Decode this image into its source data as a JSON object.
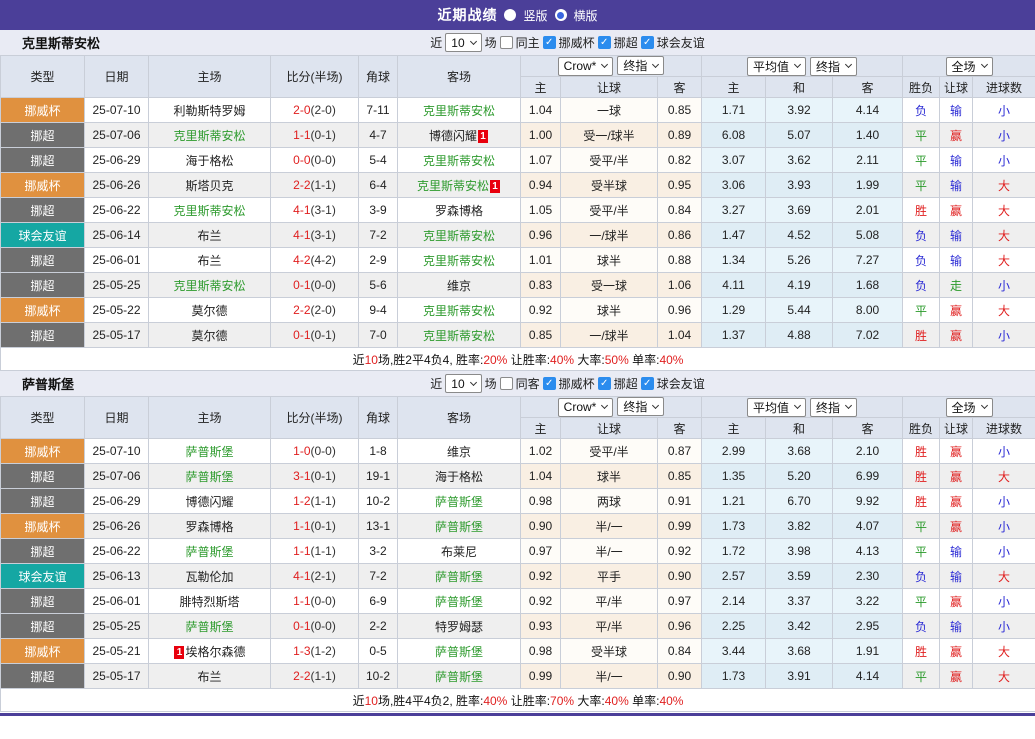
{
  "title_bar": {
    "title": "近期战绩",
    "radios": [
      {
        "label": "竖版",
        "selected": false
      },
      {
        "label": "横版",
        "selected": true
      }
    ]
  },
  "colors": {
    "accent_purple": "#4B3F99",
    "cup_orange": "#E0913F",
    "league_gray": "#6F6F6F",
    "friendly_teal": "#15A7A3",
    "focus_team_green": "#2E9B2E",
    "result_red": "#E01F1F",
    "result_green": "#2A9A2A",
    "result_blue": "#2B2BD5",
    "red_card": "#E8000D"
  },
  "filters": {
    "prefix": "近",
    "count": "10",
    "suffix": "场",
    "leagues": [
      "挪威杯",
      "挪超",
      "球会友谊"
    ]
  },
  "table_columns": {
    "left": [
      "类型",
      "日期",
      "主场",
      "比分(半场)",
      "角球",
      "客场"
    ],
    "sub": [
      "主",
      "让球",
      "客",
      "主",
      "和",
      "客",
      "胜负",
      "让球",
      "进球数"
    ]
  },
  "dropdowns": {
    "bookmaker": "Crow*",
    "final1": "终指",
    "average": "平均值",
    "final2": "终指",
    "scope": "全场"
  },
  "type_class_map": {
    "挪威杯": "t-cup",
    "挪超": "t-lge",
    "球会友谊": "t-fri"
  },
  "result_colors": {
    "胜": "red",
    "平": "green",
    "负": "blue",
    "赢": "red",
    "走": "green",
    "输": "blue",
    "大": "red",
    "小": "blue"
  },
  "sections": [
    {
      "team": "克里斯蒂安松",
      "same_option": "同主",
      "rows": [
        {
          "type": "挪威杯",
          "date": "25-07-10",
          "home": "利勒斯特罗姆",
          "home_focus": false,
          "home_red": "",
          "score": "2-0",
          "half": "(2-0)",
          "corner": "7-11",
          "away": "克里斯蒂安松",
          "away_focus": true,
          "away_red": "",
          "ah": [
            "1.04",
            "一球",
            "0.85"
          ],
          "eu": [
            "1.71",
            "3.92",
            "4.14"
          ],
          "res": [
            "负",
            "输",
            "小"
          ]
        },
        {
          "type": "挪超",
          "date": "25-07-06",
          "home": "克里斯蒂安松",
          "home_focus": true,
          "home_red": "",
          "score": "1-1",
          "half": "(0-1)",
          "corner": "4-7",
          "away": "博德闪耀",
          "away_focus": false,
          "away_red": "after",
          "ah": [
            "1.00",
            "受一/球半",
            "0.89"
          ],
          "eu": [
            "6.08",
            "5.07",
            "1.40"
          ],
          "res": [
            "平",
            "赢",
            "小"
          ]
        },
        {
          "type": "挪超",
          "date": "25-06-29",
          "home": "海于格松",
          "home_focus": false,
          "home_red": "",
          "score": "0-0",
          "half": "(0-0)",
          "corner": "5-4",
          "away": "克里斯蒂安松",
          "away_focus": true,
          "away_red": "",
          "ah": [
            "1.07",
            "受平/半",
            "0.82"
          ],
          "eu": [
            "3.07",
            "3.62",
            "2.11"
          ],
          "res": [
            "平",
            "输",
            "小"
          ]
        },
        {
          "type": "挪威杯",
          "date": "25-06-26",
          "home": "斯塔贝克",
          "home_focus": false,
          "home_red": "",
          "score": "2-2",
          "half": "(1-1)",
          "corner": "6-4",
          "away": "克里斯蒂安松",
          "away_focus": true,
          "away_red": "after",
          "ah": [
            "0.94",
            "受半球",
            "0.95"
          ],
          "eu": [
            "3.06",
            "3.93",
            "1.99"
          ],
          "res": [
            "平",
            "输",
            "大"
          ]
        },
        {
          "type": "挪超",
          "date": "25-06-22",
          "home": "克里斯蒂安松",
          "home_focus": true,
          "home_red": "",
          "score": "4-1",
          "half": "(3-1)",
          "corner": "3-9",
          "away": "罗森博格",
          "away_focus": false,
          "away_red": "",
          "ah": [
            "1.05",
            "受平/半",
            "0.84"
          ],
          "eu": [
            "3.27",
            "3.69",
            "2.01"
          ],
          "res": [
            "胜",
            "赢",
            "大"
          ]
        },
        {
          "type": "球会友谊",
          "date": "25-06-14",
          "home": "布兰",
          "home_focus": false,
          "home_red": "",
          "score": "4-1",
          "half": "(3-1)",
          "corner": "7-2",
          "away": "克里斯蒂安松",
          "away_focus": true,
          "away_red": "",
          "ah": [
            "0.96",
            "一/球半",
            "0.86"
          ],
          "eu": [
            "1.47",
            "4.52",
            "5.08"
          ],
          "res": [
            "负",
            "输",
            "大"
          ]
        },
        {
          "type": "挪超",
          "date": "25-06-01",
          "home": "布兰",
          "home_focus": false,
          "home_red": "",
          "score": "4-2",
          "half": "(4-2)",
          "corner": "2-9",
          "away": "克里斯蒂安松",
          "away_focus": true,
          "away_red": "",
          "ah": [
            "1.01",
            "球半",
            "0.88"
          ],
          "eu": [
            "1.34",
            "5.26",
            "7.27"
          ],
          "res": [
            "负",
            "输",
            "大"
          ]
        },
        {
          "type": "挪超",
          "date": "25-05-25",
          "home": "克里斯蒂安松",
          "home_focus": true,
          "home_red": "",
          "score": "0-1",
          "half": "(0-0)",
          "corner": "5-6",
          "away": "维京",
          "away_focus": false,
          "away_red": "",
          "ah": [
            "0.83",
            "受一球",
            "1.06"
          ],
          "eu": [
            "4.11",
            "4.19",
            "1.68"
          ],
          "res": [
            "负",
            "走",
            "小"
          ]
        },
        {
          "type": "挪威杯",
          "date": "25-05-22",
          "home": "莫尔德",
          "home_focus": false,
          "home_red": "",
          "score": "2-2",
          "half": "(2-0)",
          "corner": "9-4",
          "away": "克里斯蒂安松",
          "away_focus": true,
          "away_red": "",
          "ah": [
            "0.92",
            "球半",
            "0.96"
          ],
          "eu": [
            "1.29",
            "5.44",
            "8.00"
          ],
          "res": [
            "平",
            "赢",
            "大"
          ]
        },
        {
          "type": "挪超",
          "date": "25-05-17",
          "home": "莫尔德",
          "home_focus": false,
          "home_red": "",
          "score": "0-1",
          "half": "(0-1)",
          "corner": "7-0",
          "away": "克里斯蒂安松",
          "away_focus": true,
          "away_red": "",
          "ah": [
            "0.85",
            "一/球半",
            "1.04"
          ],
          "eu": [
            "1.37",
            "4.88",
            "7.02"
          ],
          "res": [
            "胜",
            "赢",
            "小"
          ]
        }
      ],
      "summary": [
        {
          "t": "近",
          "c": "k"
        },
        {
          "t": "10",
          "c": "r"
        },
        {
          "t": "场,胜2平4负4, 胜率:",
          "c": "k"
        },
        {
          "t": "20%",
          "c": "r"
        },
        {
          "t": " 让胜率:",
          "c": "k"
        },
        {
          "t": "40%",
          "c": "r"
        },
        {
          "t": " 大率:",
          "c": "k"
        },
        {
          "t": "50%",
          "c": "r"
        },
        {
          "t": " 单率:",
          "c": "k"
        },
        {
          "t": "40%",
          "c": "r"
        }
      ]
    },
    {
      "team": "萨普斯堡",
      "same_option": "同客",
      "rows": [
        {
          "type": "挪威杯",
          "date": "25-07-10",
          "home": "萨普斯堡",
          "home_focus": true,
          "home_red": "",
          "score": "1-0",
          "half": "(0-0)",
          "corner": "1-8",
          "away": "维京",
          "away_focus": false,
          "away_red": "",
          "ah": [
            "1.02",
            "受平/半",
            "0.87"
          ],
          "eu": [
            "2.99",
            "3.68",
            "2.10"
          ],
          "res": [
            "胜",
            "赢",
            "小"
          ]
        },
        {
          "type": "挪超",
          "date": "25-07-06",
          "home": "萨普斯堡",
          "home_focus": true,
          "home_red": "",
          "score": "3-1",
          "half": "(0-1)",
          "corner": "19-1",
          "away": "海于格松",
          "away_focus": false,
          "away_red": "",
          "ah": [
            "1.04",
            "球半",
            "0.85"
          ],
          "eu": [
            "1.35",
            "5.20",
            "6.99"
          ],
          "res": [
            "胜",
            "赢",
            "大"
          ]
        },
        {
          "type": "挪超",
          "date": "25-06-29",
          "home": "博德闪耀",
          "home_focus": false,
          "home_red": "",
          "score": "1-2",
          "half": "(1-1)",
          "corner": "10-2",
          "away": "萨普斯堡",
          "away_focus": true,
          "away_red": "",
          "ah": [
            "0.98",
            "两球",
            "0.91"
          ],
          "eu": [
            "1.21",
            "6.70",
            "9.92"
          ],
          "res": [
            "胜",
            "赢",
            "小"
          ]
        },
        {
          "type": "挪威杯",
          "date": "25-06-26",
          "home": "罗森博格",
          "home_focus": false,
          "home_red": "",
          "score": "1-1",
          "half": "(0-1)",
          "corner": "13-1",
          "away": "萨普斯堡",
          "away_focus": true,
          "away_red": "",
          "ah": [
            "0.90",
            "半/一",
            "0.99"
          ],
          "eu": [
            "1.73",
            "3.82",
            "4.07"
          ],
          "res": [
            "平",
            "赢",
            "小"
          ]
        },
        {
          "type": "挪超",
          "date": "25-06-22",
          "home": "萨普斯堡",
          "home_focus": true,
          "home_red": "",
          "score": "1-1",
          "half": "(1-1)",
          "corner": "3-2",
          "away": "布莱尼",
          "away_focus": false,
          "away_red": "",
          "ah": [
            "0.97",
            "半/一",
            "0.92"
          ],
          "eu": [
            "1.72",
            "3.98",
            "4.13"
          ],
          "res": [
            "平",
            "输",
            "小"
          ]
        },
        {
          "type": "球会友谊",
          "date": "25-06-13",
          "home": "瓦勒伦加",
          "home_focus": false,
          "home_red": "",
          "score": "4-1",
          "half": "(2-1)",
          "corner": "7-2",
          "away": "萨普斯堡",
          "away_focus": true,
          "away_red": "",
          "ah": [
            "0.92",
            "平手",
            "0.90"
          ],
          "eu": [
            "2.57",
            "3.59",
            "2.30"
          ],
          "res": [
            "负",
            "输",
            "大"
          ]
        },
        {
          "type": "挪超",
          "date": "25-06-01",
          "home": "腓特烈斯塔",
          "home_focus": false,
          "home_red": "",
          "score": "1-1",
          "half": "(0-0)",
          "corner": "6-9",
          "away": "萨普斯堡",
          "away_focus": true,
          "away_red": "",
          "ah": [
            "0.92",
            "平/半",
            "0.97"
          ],
          "eu": [
            "2.14",
            "3.37",
            "3.22"
          ],
          "res": [
            "平",
            "赢",
            "小"
          ]
        },
        {
          "type": "挪超",
          "date": "25-05-25",
          "home": "萨普斯堡",
          "home_focus": true,
          "home_red": "",
          "score": "0-1",
          "half": "(0-0)",
          "corner": "2-2",
          "away": "特罗姆瑟",
          "away_focus": false,
          "away_red": "",
          "ah": [
            "0.93",
            "平/半",
            "0.96"
          ],
          "eu": [
            "2.25",
            "3.42",
            "2.95"
          ],
          "res": [
            "负",
            "输",
            "小"
          ]
        },
        {
          "type": "挪威杯",
          "date": "25-05-21",
          "home": "埃格尔森德",
          "home_focus": false,
          "home_red": "before",
          "score": "1-3",
          "half": "(1-2)",
          "corner": "0-5",
          "away": "萨普斯堡",
          "away_focus": true,
          "away_red": "",
          "ah": [
            "0.98",
            "受半球",
            "0.84"
          ],
          "eu": [
            "3.44",
            "3.68",
            "1.91"
          ],
          "res": [
            "胜",
            "赢",
            "大"
          ]
        },
        {
          "type": "挪超",
          "date": "25-05-17",
          "home": "布兰",
          "home_focus": false,
          "home_red": "",
          "score": "2-2",
          "half": "(1-1)",
          "corner": "10-2",
          "away": "萨普斯堡",
          "away_focus": true,
          "away_red": "",
          "ah": [
            "0.99",
            "半/一",
            "0.90"
          ],
          "eu": [
            "1.73",
            "3.91",
            "4.14"
          ],
          "res": [
            "平",
            "赢",
            "大"
          ]
        }
      ],
      "summary": [
        {
          "t": "近",
          "c": "k"
        },
        {
          "t": "10",
          "c": "r"
        },
        {
          "t": "场,胜4平4负2, 胜率:",
          "c": "k"
        },
        {
          "t": "40%",
          "c": "r"
        },
        {
          "t": " 让胜率:",
          "c": "k"
        },
        {
          "t": "70%",
          "c": "r"
        },
        {
          "t": " 大率:",
          "c": "k"
        },
        {
          "t": "40%",
          "c": "r"
        },
        {
          "t": " 单率:",
          "c": "k"
        },
        {
          "t": "40%",
          "c": "r"
        }
      ]
    }
  ]
}
